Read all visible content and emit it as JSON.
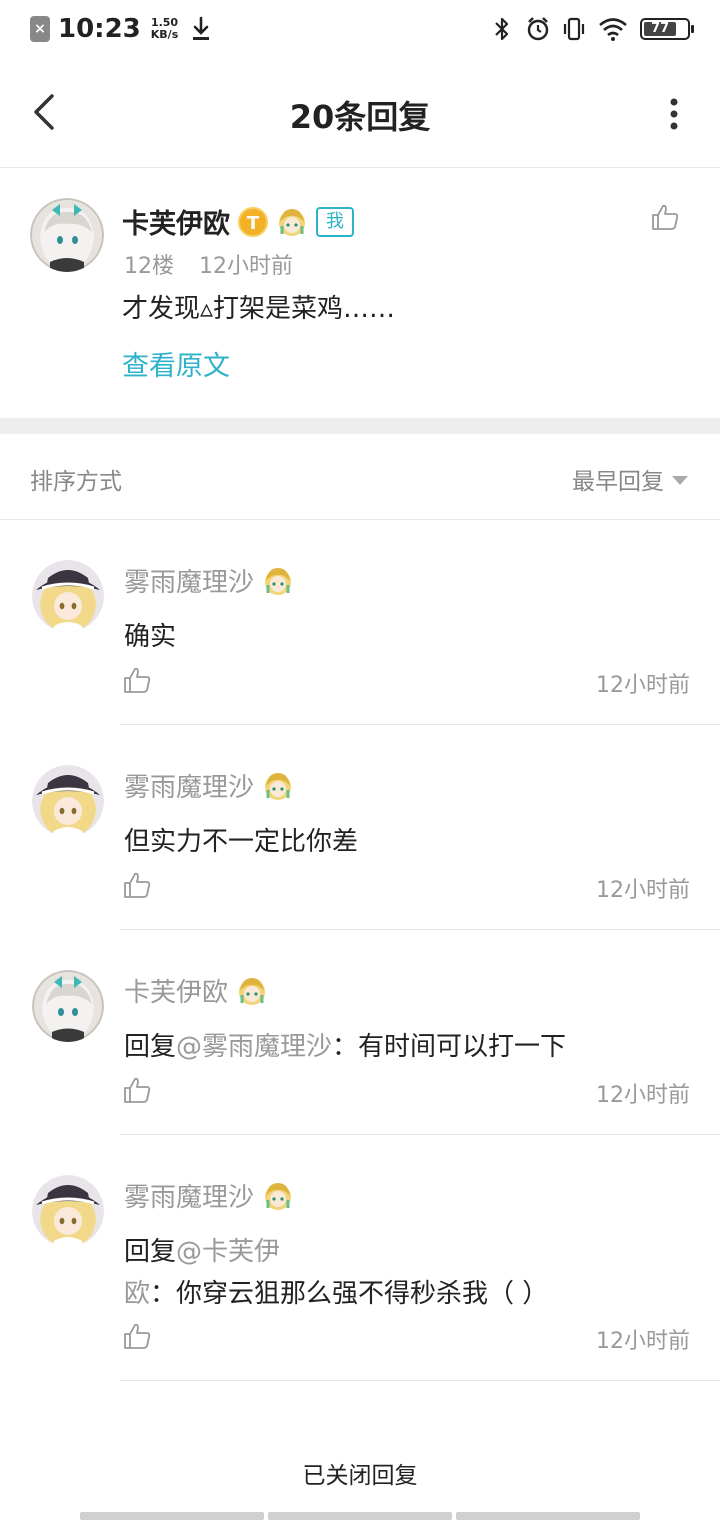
{
  "status_bar": {
    "time": "10:23",
    "speed_value": "1.50",
    "speed_unit": "KB/s",
    "battery": "77"
  },
  "header": {
    "title": "20条回复"
  },
  "post": {
    "author": "卡芙伊欧",
    "coin_badge": "T",
    "me_tag": "我",
    "floor": "12楼",
    "time": "12小时前",
    "text": "才发现▵打架是菜鸡……",
    "view_original": "查看原文"
  },
  "sort": {
    "label": "排序方式",
    "selected": "最早回复"
  },
  "replies": [
    {
      "name": "雾雨魔理沙",
      "avatar": "marisa",
      "prefix": "",
      "mention": "",
      "text": "确实",
      "time": "12小时前"
    },
    {
      "name": "雾雨魔理沙",
      "avatar": "marisa",
      "prefix": "",
      "mention": "",
      "text": "但实力不一定比你差",
      "time": "12小时前"
    },
    {
      "name": "卡芙伊欧",
      "avatar": "silver",
      "prefix": "回复",
      "mention": "@雾雨魔理沙",
      "text": "：有时间可以打一下",
      "time": "12小时前"
    },
    {
      "name": "雾雨魔理沙",
      "avatar": "marisa",
      "prefix": "回复",
      "mention": "@卡芙伊欧",
      "text": "：你穿云狙那么强不得秒杀我（ ）",
      "time": "12小时前"
    }
  ],
  "footer": {
    "closed_text": "已关闭回复"
  },
  "colors": {
    "accent": "#2db3c9",
    "coin": "#f2b127",
    "muted": "#999999"
  }
}
